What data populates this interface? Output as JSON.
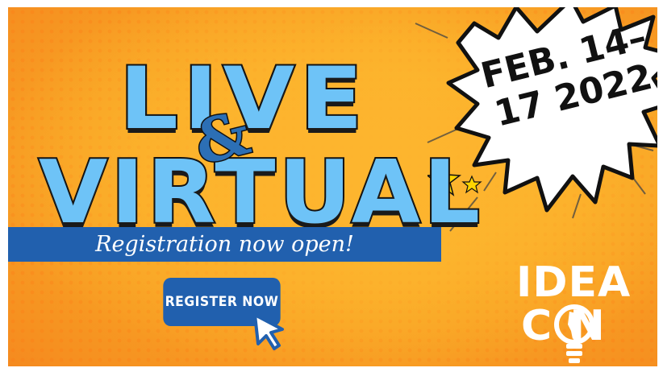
{
  "headline": {
    "line1": "LIVE",
    "ampersand": "&",
    "line2": "VIRTUAL"
  },
  "registration_banner": "Registration now open!",
  "register_button": "REGISTER NOW",
  "date_burst": {
    "line1": "FEB. 14–",
    "line2": "17 2022"
  },
  "logo": {
    "top": "IDEA",
    "bottom": "C N"
  },
  "colors": {
    "background": "#f9a825",
    "headline_fill": "#6ec3f7",
    "brand_blue": "#2160ae",
    "star_yellow": "#ffd400"
  },
  "icons": [
    "cursor-arrow-icon",
    "star-icon",
    "lightbulb-icon"
  ]
}
